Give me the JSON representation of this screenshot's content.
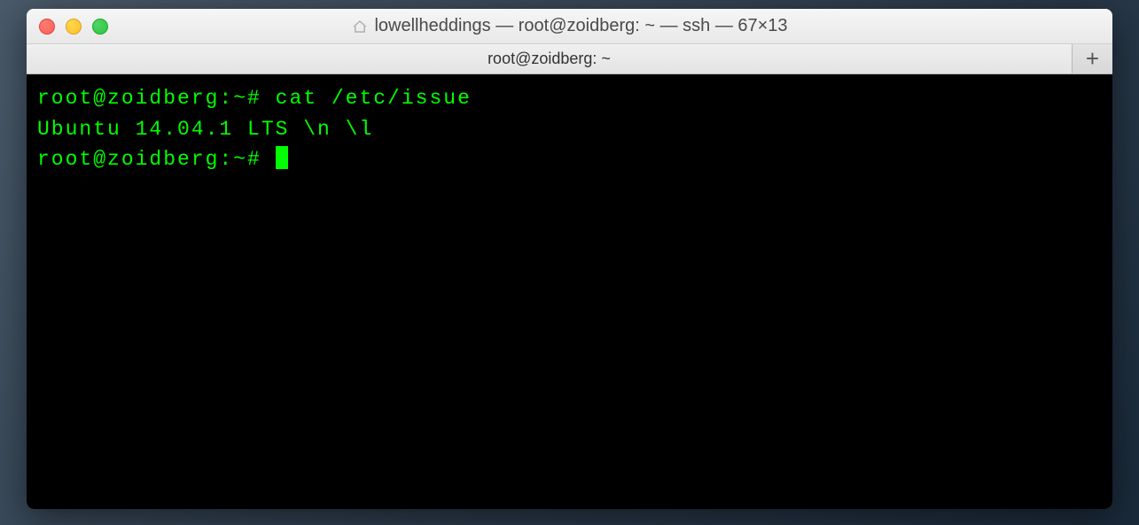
{
  "window": {
    "title": "lowellheddings — root@zoidberg: ~ — ssh — 67×13"
  },
  "tabs": {
    "active": "root@zoidberg: ~"
  },
  "terminal": {
    "line1_prompt": "root@zoidberg:~# ",
    "line1_command": "cat /etc/issue",
    "line2": "Ubuntu 14.04.1 LTS \\n \\l",
    "line3": "",
    "line4_prompt": "root@zoidberg:~# "
  }
}
